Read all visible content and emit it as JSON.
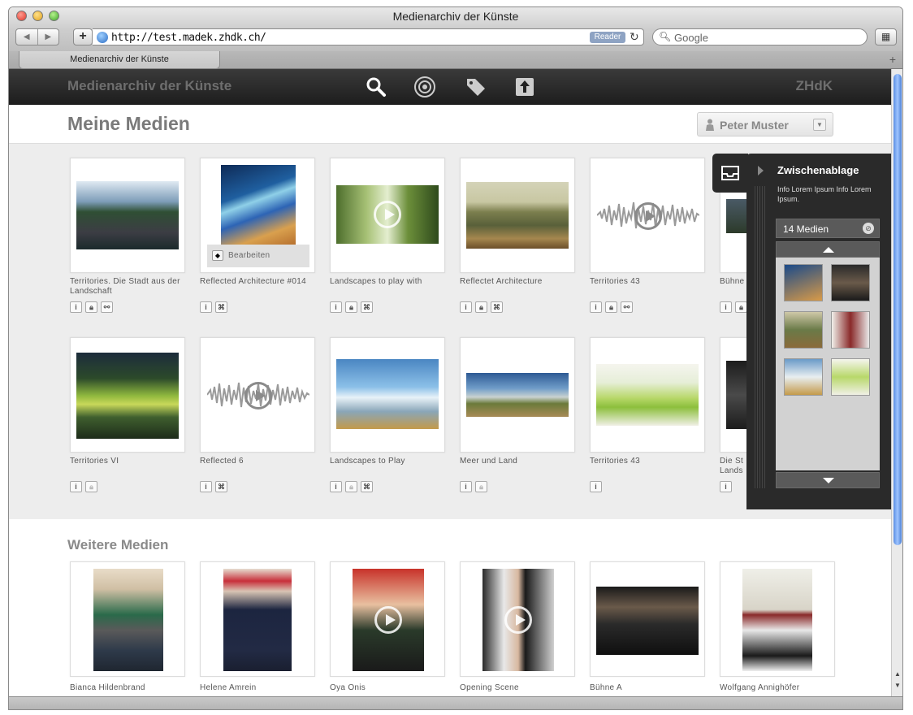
{
  "window": {
    "title": "Medienarchiv der Künste"
  },
  "browser": {
    "url": "http://test.madek.zhdk.ch/",
    "reader_label": "Reader",
    "search_placeholder": "Google",
    "tab_label": "Medienarchiv der Künste"
  },
  "app": {
    "brand": "Medienarchiv der Künste",
    "institution": "ZHdK",
    "toolbar_icons": [
      "search-icon",
      "explore-icon",
      "tag-icon",
      "upload-icon"
    ]
  },
  "page": {
    "title": "Meine Medien",
    "user_name": "Peter Muster",
    "section2_title": "Weitere Medien",
    "edit_label": "Bearbeiten"
  },
  "my_media": [
    {
      "title": "Territories. Die Stadt aus der Landschaft",
      "type": "image",
      "icons": [
        "i",
        "lock",
        "link"
      ]
    },
    {
      "title": "Reflected Architecture #014",
      "type": "image",
      "icons": [
        "i",
        "set"
      ]
    },
    {
      "title": "Landscapes to play with",
      "type": "video",
      "icons": [
        "i",
        "lock",
        "set"
      ]
    },
    {
      "title": "Reflectet Architecture",
      "type": "image",
      "icons": [
        "i",
        "lock",
        "set"
      ]
    },
    {
      "title": "Territories 43",
      "type": "audio",
      "icons": [
        "i",
        "lock",
        "link"
      ]
    },
    {
      "title": "Bühne",
      "type": "image",
      "icons": [
        "i",
        "lock"
      ]
    },
    {
      "title": "Territories VI",
      "type": "image",
      "icons": [
        "i",
        "lock"
      ]
    },
    {
      "title": "Reflected 6",
      "type": "audio",
      "icons": [
        "i",
        "set"
      ]
    },
    {
      "title": "Landscapes to Play",
      "type": "image",
      "icons": [
        "i",
        "lock",
        "set"
      ]
    },
    {
      "title": "Meer und Land",
      "type": "image",
      "icons": [
        "i",
        "lock"
      ]
    },
    {
      "title": "Territories 43",
      "type": "image",
      "icons": [
        "i"
      ]
    },
    {
      "title": "Die St Lands",
      "type": "image",
      "icons": [
        "i"
      ]
    }
  ],
  "other_media": [
    {
      "title": "Bianca Hildenbrand",
      "type": "image"
    },
    {
      "title": "Helene Amrein",
      "type": "image"
    },
    {
      "title": "Oya Onis",
      "type": "video"
    },
    {
      "title": "Opening Scene",
      "type": "video"
    },
    {
      "title": "Bühne A",
      "type": "image"
    },
    {
      "title": "Wolfgang Annighöfer",
      "type": "image"
    }
  ],
  "clipboard": {
    "title": "Zwischenablage",
    "info": "Info Lorem Ipsum Info Lorem Ipsum.",
    "count_label": "14 Medien"
  },
  "colors": {
    "appbar": "#262626",
    "background_grey": "#ededed",
    "scrollbar_accent": "#5b8fe3"
  }
}
